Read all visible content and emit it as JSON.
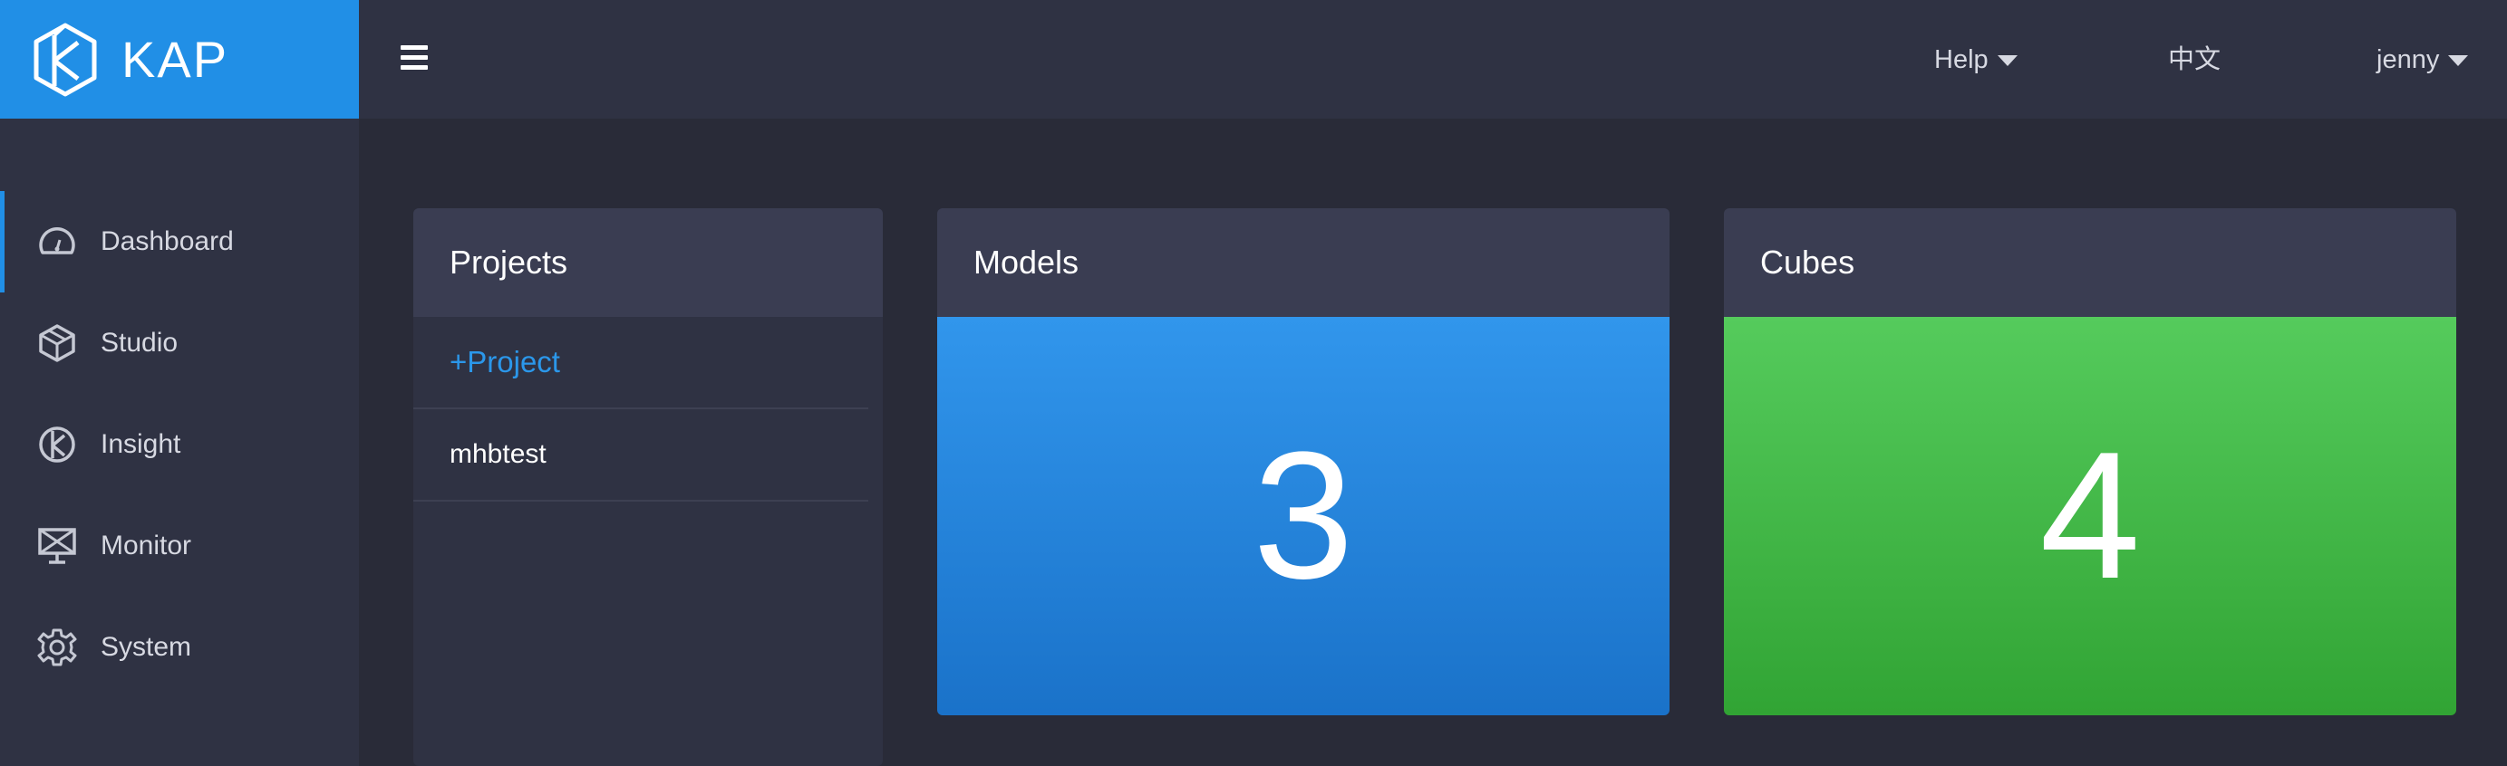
{
  "brand": {
    "name": "KAP",
    "color": "#218fe6"
  },
  "header": {
    "menu_icon": "hamburger-icon",
    "help_label": "Help",
    "language_label": "中文",
    "user_label": "jenny"
  },
  "sidebar": {
    "items": [
      {
        "label": "Dashboard",
        "icon": "dashboard-gauge-icon",
        "active": true
      },
      {
        "label": "Studio",
        "icon": "cube-icon",
        "active": false
      },
      {
        "label": "Insight",
        "icon": "insight-icon",
        "active": false
      },
      {
        "label": "Monitor",
        "icon": "monitor-icon",
        "active": false
      },
      {
        "label": "System",
        "icon": "gear-icon",
        "active": false
      }
    ]
  },
  "main": {
    "projects": {
      "title": "Projects",
      "add_label": "+Project",
      "items": [
        "mhbtest"
      ]
    },
    "models": {
      "title": "Models",
      "count": "3",
      "color": "#2a87e0"
    },
    "cubes": {
      "title": "Cubes",
      "count": "4",
      "color": "#44b848"
    }
  }
}
